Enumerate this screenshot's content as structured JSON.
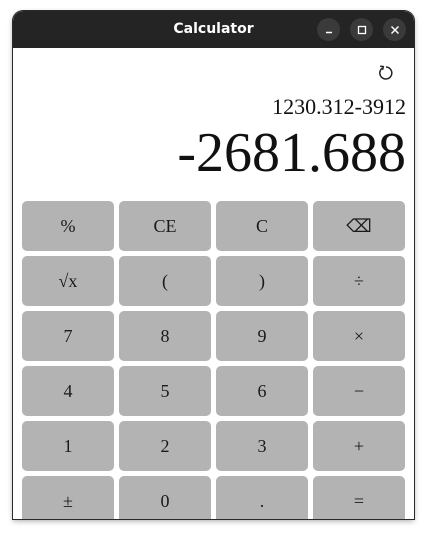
{
  "window": {
    "title": "Calculator",
    "controls": {
      "minimize": "minimize-icon",
      "maximize": "maximize-icon",
      "close": "close-icon"
    }
  },
  "display": {
    "history_icon": "history-icon",
    "expression": "1230.312-3912",
    "result": "-2681.688"
  },
  "keys": [
    {
      "label": "%",
      "name": "percent-key"
    },
    {
      "label": "CE",
      "name": "clear-entry-key"
    },
    {
      "label": "C",
      "name": "clear-key"
    },
    {
      "label": "⌫",
      "name": "backspace-key"
    },
    {
      "label": "√x",
      "name": "square-root-key"
    },
    {
      "label": "(",
      "name": "open-paren-key"
    },
    {
      "label": ")",
      "name": "close-paren-key"
    },
    {
      "label": "÷",
      "name": "divide-key"
    },
    {
      "label": "7",
      "name": "digit-7-key"
    },
    {
      "label": "8",
      "name": "digit-8-key"
    },
    {
      "label": "9",
      "name": "digit-9-key"
    },
    {
      "label": "×",
      "name": "multiply-key"
    },
    {
      "label": "4",
      "name": "digit-4-key"
    },
    {
      "label": "5",
      "name": "digit-5-key"
    },
    {
      "label": "6",
      "name": "digit-6-key"
    },
    {
      "label": "−",
      "name": "subtract-key"
    },
    {
      "label": "1",
      "name": "digit-1-key"
    },
    {
      "label": "2",
      "name": "digit-2-key"
    },
    {
      "label": "3",
      "name": "digit-3-key"
    },
    {
      "label": "+",
      "name": "add-key"
    },
    {
      "label": "±",
      "name": "negate-key"
    },
    {
      "label": "0",
      "name": "digit-0-key"
    },
    {
      "label": ".",
      "name": "decimal-key"
    },
    {
      "label": "=",
      "name": "equals-key"
    }
  ],
  "colors": {
    "titlebar": "#242424",
    "key_background": "#b3b3b3",
    "window_button": "#3a3a3a"
  }
}
